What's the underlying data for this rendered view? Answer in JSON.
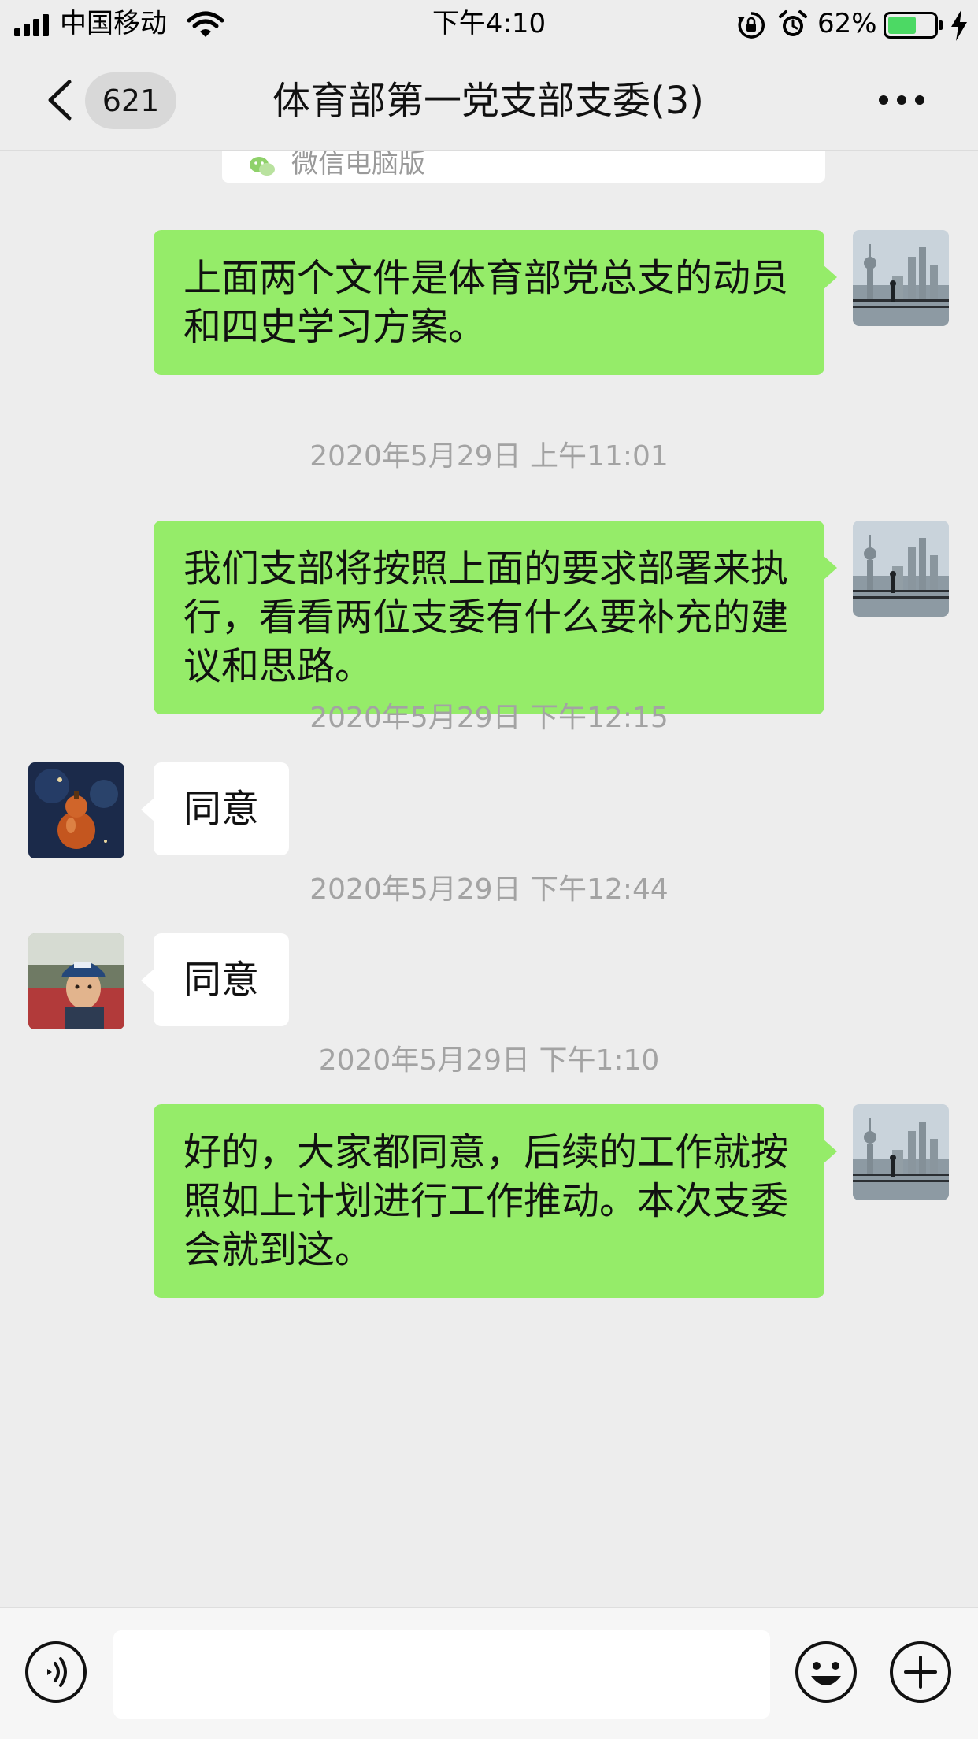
{
  "status_bar": {
    "carrier": "中国移动",
    "time": "下午4:10",
    "battery_percent": "62%",
    "battery_level": 0.62,
    "signal_bars": 4,
    "battery_color": "#4cd964"
  },
  "header": {
    "unread_count": "621",
    "title": "体育部第一党支部支委(3)",
    "back_icon": "chevron-left-icon",
    "more_icon": "more-dots-icon"
  },
  "file_card": {
    "source": "微信电脑版",
    "icon": "wechat-icon"
  },
  "messages": [
    {
      "type": "sent",
      "text": "上面两个文件是体育部党总支的动员和四史学习方案。",
      "avatar": "skyline-avatar"
    },
    {
      "type": "timestamp",
      "text": "2020年5月29日 上午11:01"
    },
    {
      "type": "sent",
      "text": "我们支部将按照上面的要求部署来执行，看看两位支委有什么要补充的建议和思路。",
      "avatar": "skyline-avatar"
    },
    {
      "type": "timestamp",
      "text": "2020年5月29日 下午12:15"
    },
    {
      "type": "received",
      "text": "同意",
      "avatar": "gourd-avatar"
    },
    {
      "type": "timestamp",
      "text": "2020年5月29日 下午12:44"
    },
    {
      "type": "received",
      "text": "同意",
      "avatar": "cap-man-avatar"
    },
    {
      "type": "timestamp",
      "text": "2020年5月29日 下午1:10"
    },
    {
      "type": "sent",
      "text": "好的，大家都同意，后续的工作就按照如上计划进行工作推动。本次支委会就到这。",
      "avatar": "skyline-avatar"
    }
  ],
  "input_bar": {
    "message_value": "",
    "voice_icon": "voice-icon",
    "emoji_icon": "emoji-icon",
    "plus_icon": "plus-icon"
  },
  "colors": {
    "sent_bubble": "#95ec69",
    "received_bubble": "#ffffff",
    "background": "#ededed",
    "timestamp_text": "#a3a3a3"
  }
}
